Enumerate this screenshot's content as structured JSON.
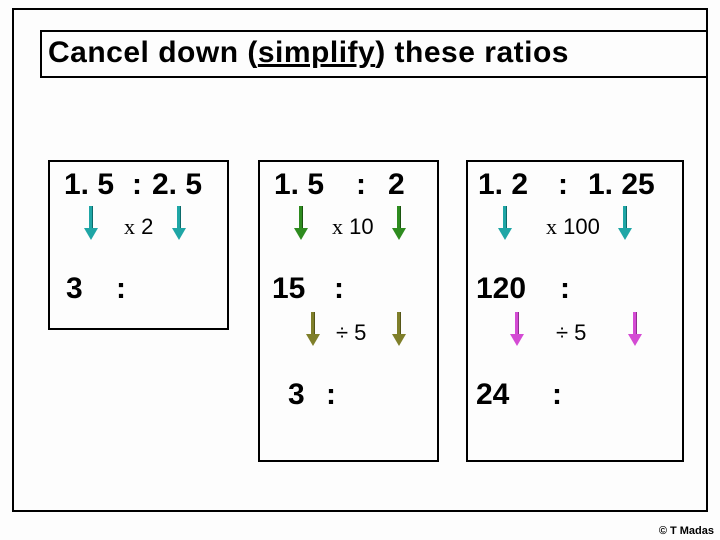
{
  "title_pre": "Cancel down (",
  "title_ul": "simplify",
  "title_post": ") these ratios",
  "cards": {
    "a": {
      "row1_l": "1. 5",
      "row1_m": ":",
      "row1_r": "2. 5",
      "op1": "x 2",
      "row2_l": "3",
      "row2_m": ":",
      "row2_r": ""
    },
    "b": {
      "row1_l": "1. 5",
      "row1_m": ":",
      "row1_r": "2",
      "op1": "x 10",
      "row2_l": "15",
      "row2_m": ":",
      "row2_r": "",
      "op2": "÷ 5",
      "row3_l": "3",
      "row3_m": ":",
      "row3_r": ""
    },
    "c": {
      "row1_l": "1. 2",
      "row1_m": ":",
      "row1_r": "1. 25",
      "op1": "x 100",
      "row2_l": "120",
      "row2_m": ":",
      "row2_r": "",
      "op2": "÷ 5",
      "row3_l": "24",
      "row3_m": ":",
      "row3_r": ""
    }
  },
  "credit": "© T Madas"
}
